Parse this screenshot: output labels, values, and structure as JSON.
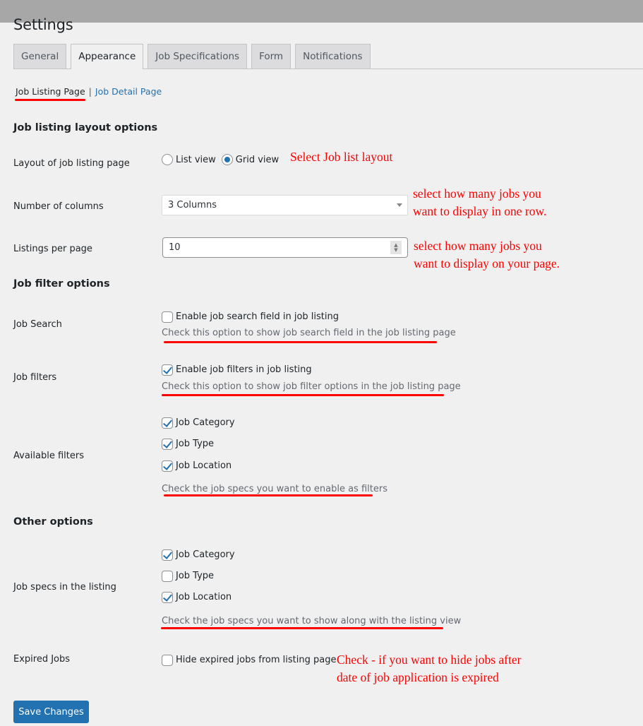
{
  "page": {
    "title": "Settings"
  },
  "tabs": [
    {
      "label": "General",
      "active": false
    },
    {
      "label": "Appearance",
      "active": true
    },
    {
      "label": "Job Specifications",
      "active": false
    },
    {
      "label": "Form",
      "active": false
    },
    {
      "label": "Notifications",
      "active": false
    }
  ],
  "subnav": {
    "current": "Job Listing Page",
    "separator": "|",
    "link": "Job Detail Page"
  },
  "sections": {
    "layout": {
      "title": "Job listing layout options",
      "layout_label": "Layout of job listing page",
      "layout_options": [
        {
          "label": "List view",
          "checked": false
        },
        {
          "label": "Grid view",
          "checked": true
        }
      ],
      "columns_label": "Number of columns",
      "columns_value": "3 Columns",
      "per_page_label": "Listings per page",
      "per_page_value": "10"
    },
    "filter": {
      "title": "Job filter options",
      "search_label": "Job Search",
      "search_option": {
        "label": "Enable job search field in job listing",
        "checked": false
      },
      "search_desc": "Check this option to show job search field in the job listing page",
      "filters_label": "Job filters",
      "filters_option": {
        "label": "Enable job filters in job listing",
        "checked": true
      },
      "filters_desc": "Check this option to show job filter options in the job listing page",
      "available_label": "Available filters",
      "available_options": [
        {
          "label": "Job Category",
          "checked": true
        },
        {
          "label": "Job Type",
          "checked": true
        },
        {
          "label": "Job Location",
          "checked": true
        }
      ],
      "available_desc": "Check the job specs you want to enable as filters"
    },
    "other": {
      "title": "Other options",
      "specs_label": "Job specs in the listing",
      "specs_options": [
        {
          "label": "Job Category",
          "checked": true
        },
        {
          "label": "Job Type",
          "checked": false
        },
        {
          "label": "Job Location",
          "checked": true
        }
      ],
      "specs_desc": "Check the job specs you want to show along with the listing view",
      "expired_label": "Expired Jobs",
      "expired_option": {
        "label": "Hide expired jobs from listing page",
        "checked": false
      }
    }
  },
  "annotations": {
    "layout": "Select Job list layout",
    "columns_line1": "select how many jobs you",
    "columns_line2": "want to display in one row.",
    "per_page_line1": "select how many jobs you",
    "per_page_line2": "want to display on your page.",
    "expired_line1": "Check - if you want to hide jobs after",
    "expired_line2": "date of job application is expired"
  },
  "buttons": {
    "save": "Save Changes"
  },
  "colors": {
    "accent": "#2271b1",
    "annotation": "#ff0000",
    "background": "#f0f0f1"
  }
}
